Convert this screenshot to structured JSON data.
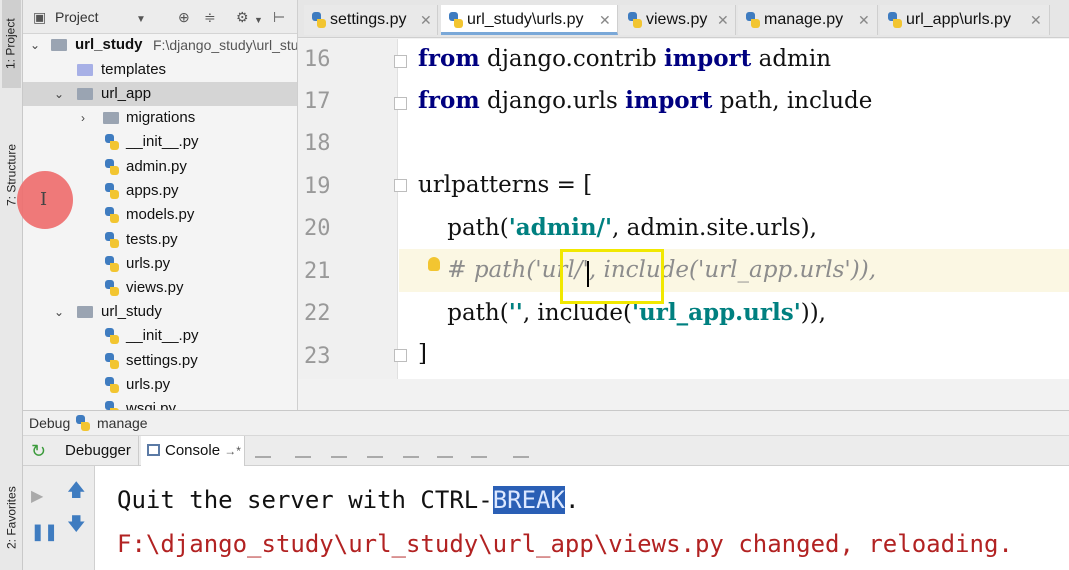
{
  "sidebar": {
    "project_tab": "1: Project",
    "structure_tab": "7: Structure",
    "favorites_tab": "2: Favorites"
  },
  "project": {
    "toolbar_label": "Project",
    "root_name": "url_study",
    "root_path": "F:\\django_study\\url_study",
    "items": [
      {
        "label": "templates"
      },
      {
        "label": "url_app"
      },
      {
        "label": "migrations"
      },
      {
        "label": "__init__.py"
      },
      {
        "label": "admin.py"
      },
      {
        "label": "apps.py"
      },
      {
        "label": "models.py"
      },
      {
        "label": "tests.py"
      },
      {
        "label": "urls.py"
      },
      {
        "label": "views.py"
      },
      {
        "label": "url_study"
      },
      {
        "label": "__init__.py"
      },
      {
        "label": "settings.py"
      },
      {
        "label": "urls.py"
      },
      {
        "label": "wsgi.py"
      }
    ]
  },
  "tabs": [
    {
      "label": "settings.py"
    },
    {
      "label": "url_study\\urls.py"
    },
    {
      "label": "views.py"
    },
    {
      "label": "manage.py"
    },
    {
      "label": "url_app\\urls.py"
    }
  ],
  "editor": {
    "line_numbers": [
      "16",
      "17",
      "18",
      "19",
      "20",
      "21",
      "22",
      "23"
    ],
    "line16": {
      "kw1": "from",
      "mod": " django.contrib ",
      "kw2": "import",
      "name": " admin"
    },
    "line17": {
      "kw1": "from",
      "mod": " django.urls ",
      "kw2": "import",
      "name": " path, include"
    },
    "line19": "urlpatterns = [",
    "line20": {
      "pre": "    path(",
      "str": "'admin/'",
      "post": ", admin.site.urls),"
    },
    "line21": "    # path('url/', include('url_app.urls')),",
    "line22": {
      "pre": "    path(",
      "str1": "''",
      "mid": ", include(",
      "str2": "'url_app.urls'",
      "post": ")),"
    },
    "line23": "]"
  },
  "debug": {
    "title": "Debug",
    "config": "manage",
    "debugger_tab": "Debugger",
    "console_tab": "Console"
  },
  "console": {
    "line1_pre": "Quit the server with CTRL-",
    "line1_hl": "BREAK",
    "line1_post": ".",
    "line2": "F:\\django_study\\url_study\\url_app\\views.py changed, reloading."
  },
  "colors": {
    "keyword": "#000080",
    "string": "#008080",
    "comment": "#8c8c8c",
    "console_error": "#b22222",
    "highlight_box": "#f1e800"
  }
}
